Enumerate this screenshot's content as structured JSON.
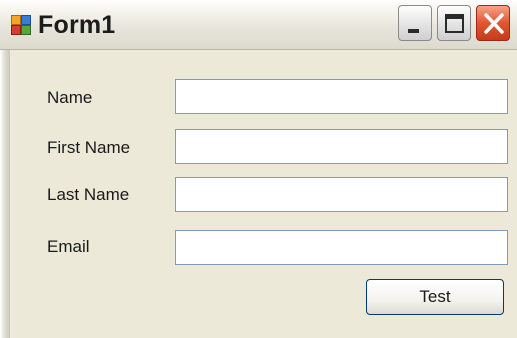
{
  "window": {
    "title": "Form1",
    "controls": {
      "minimize_icon": "minimize-icon",
      "maximize_icon": "maximize-icon",
      "close_icon": "close-icon"
    }
  },
  "form": {
    "name": {
      "label": "Name",
      "value": ""
    },
    "first_name": {
      "label": "First Name",
      "value": ""
    },
    "last_name": {
      "label": "Last Name",
      "value": ""
    },
    "email": {
      "label": "Email",
      "value": ""
    },
    "test_button_label": "Test"
  },
  "colors": {
    "window_background": "#ece9d8",
    "field_border": "#7f9db9",
    "close_button": "#e2562f"
  }
}
